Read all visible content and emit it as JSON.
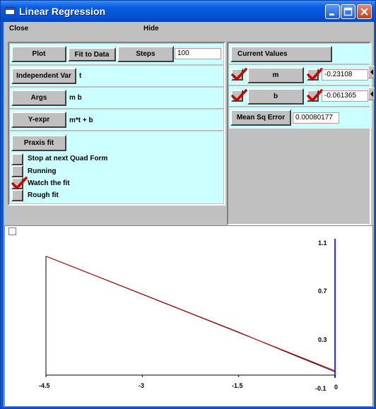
{
  "window": {
    "title": "Linear Regression"
  },
  "menu": {
    "close": "Close",
    "hide": "Hide"
  },
  "controls": {
    "plot": "Plot",
    "fit_to_data": "Fit to Data",
    "steps": "Steps",
    "steps_value": "100",
    "independent_var": "Independent Var",
    "independent_var_value": "t",
    "args": "Args",
    "args_value": "m b",
    "y_expr": "Y-expr",
    "y_expr_value": "m*t + b",
    "praxis_fit": "Praxis fit",
    "options": [
      {
        "label": "Stop at next Quad Form",
        "checked": false
      },
      {
        "label": "Running",
        "checked": false
      },
      {
        "label": "Watch the fit",
        "checked": true
      },
      {
        "label": "Rough fit",
        "checked": false
      }
    ]
  },
  "values": {
    "header": "Current Values",
    "params": [
      {
        "name": "m",
        "value": "-0.23108",
        "checked_left": true,
        "checked_right": true
      },
      {
        "name": "b",
        "value": "-0.061365",
        "checked_left": true,
        "checked_right": true
      }
    ],
    "mse_label": "Mean Sq Error",
    "mse_value": "0.00080177"
  },
  "colors": {
    "data_line": "#000000",
    "fit_line": "#cc0000",
    "accent_bar": "#3030ff",
    "panel_bg": "#ccffff"
  },
  "chart_data": {
    "type": "line",
    "title": "",
    "xlabel": "",
    "ylabel": "",
    "xlim": [
      -4.5,
      0
    ],
    "ylim": [
      -0.1,
      1.1
    ],
    "x_ticks": [
      "-4.5",
      "-3",
      "-1.5",
      "0"
    ],
    "y_ticks": [
      "1.1",
      "0.7",
      "0.3",
      "-0.1"
    ],
    "series": [
      {
        "x": [
          -4.5,
          -3.5,
          -2.5,
          -1.5,
          -0.8,
          0
        ],
        "y": [
          0.98,
          0.75,
          0.52,
          0.29,
          0.12,
          -0.07
        ]
      },
      {
        "x": [
          -4.5,
          0
        ],
        "y": [
          0.98,
          -0.06
        ]
      }
    ]
  }
}
